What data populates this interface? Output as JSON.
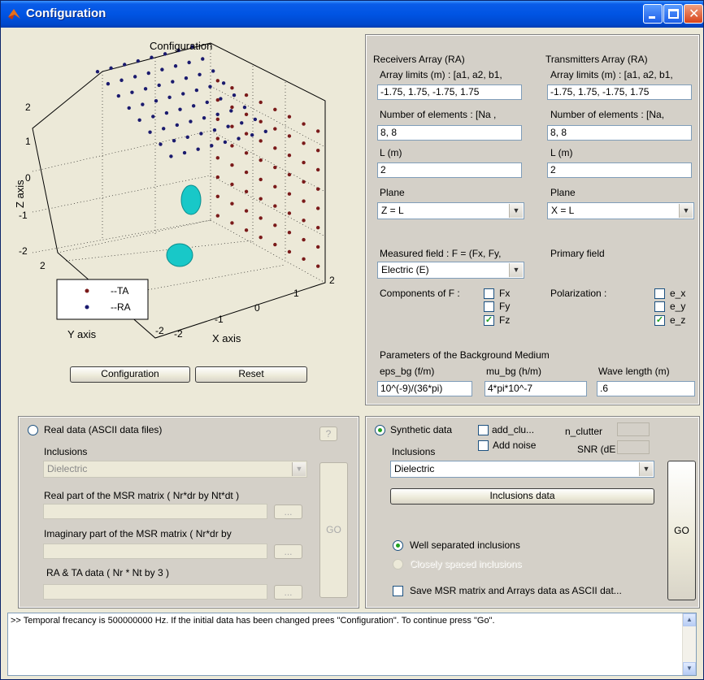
{
  "window": {
    "title": "Configuration"
  },
  "plot": {
    "title": "Configuration",
    "zlabel": "Z axis",
    "ylabel": "Y axis",
    "xlabel": "X axis",
    "zticks": [
      "2",
      "1",
      "0",
      "-1",
      "-2"
    ],
    "yticks": [
      "2",
      "-2"
    ],
    "xticks": [
      "2",
      "1",
      "0",
      "-1",
      "-2"
    ],
    "legend": [
      "--TA",
      "--RA"
    ],
    "ta_color": "#7a1a1a",
    "ra_color": "#1a1a6e",
    "inclusion_color": "#18c8c8"
  },
  "plot_buttons": {
    "configuration": "Configuration",
    "reset": "Reset"
  },
  "ra": {
    "header": "Receivers Array (RA)",
    "limits_label": "Array limits (m) : [a1, a2, b1,",
    "limits_value": "-1.75, 1.75, -1.75, 1.75",
    "elements_label": "Number of elements : [Na ,",
    "elements_value": "8, 8",
    "l_label": "L (m)",
    "l_value": "2",
    "plane_label": "Plane",
    "plane_value": "Z = L"
  },
  "ta": {
    "header": "Transmitters Array (RA)",
    "limits_label": "Array limits (m) : [a1, a2, b1,",
    "limits_value": "-1.75, 1.75, -1.75, 1.75",
    "elements_label": "Number of elements : [Na,",
    "elements_value": "8, 8",
    "l_label": "L (m)",
    "l_value": "2",
    "plane_label": "Plane",
    "plane_value": "X = L"
  },
  "field": {
    "measured_label": "Measured field : F = (Fx, Fy,",
    "measured_value": "Electric (E)",
    "primary_label": "Primary field",
    "components_label": "Components of F :",
    "fx": "Fx",
    "fy": "Fy",
    "fz": "Fz",
    "polarization_label": "Polarization :",
    "ex": "e_x",
    "ey": "e_y",
    "ez": "e_z"
  },
  "medium": {
    "header": "Parameters of the Background Medium",
    "eps_label": "eps_bg (f/m)",
    "eps_value": "10^(-9)/(36*pi)",
    "mu_label": "mu_bg (h/m)",
    "mu_value": "4*pi*10^-7",
    "wave_label": "Wave length (m)",
    "wave_value": ".6"
  },
  "real": {
    "radio_label": "Real data (ASCII data files)",
    "help": "?",
    "inclusions_label": "Inclusions",
    "inclusions_value": "Dielectric",
    "real_label": "Real part of the MSR matrix ( Nr*dr by Nt*dt )",
    "imag_label": "Imaginary part of the MSR matrix ( Nr*dr by",
    "arrays_label": "RA & TA  data  ( Nr * Nt by 3 )",
    "browse": "...",
    "go": "GO"
  },
  "synthetic": {
    "radio_label": "Synthetic data",
    "add_clutter": "add_clu...",
    "add_noise": "Add noise",
    "n_clutter": "n_clutter",
    "snr": "SNR (dE",
    "inclusions_label": "Inclusions",
    "inclusions_value": "Dielectric",
    "inclusions_data": "Inclusions data",
    "go": "GO",
    "well_separated": "Well separated inclusions",
    "closely_spaced": "Closely spaced inclusions",
    "save": "Save MSR matrix and Arrays data as ASCII dat..."
  },
  "console": {
    "text": ">> Temporal frecancy is 500000000 Hz.     If the initial data has been changed prees \"Configuration\". To continue press \"Go\"."
  }
}
